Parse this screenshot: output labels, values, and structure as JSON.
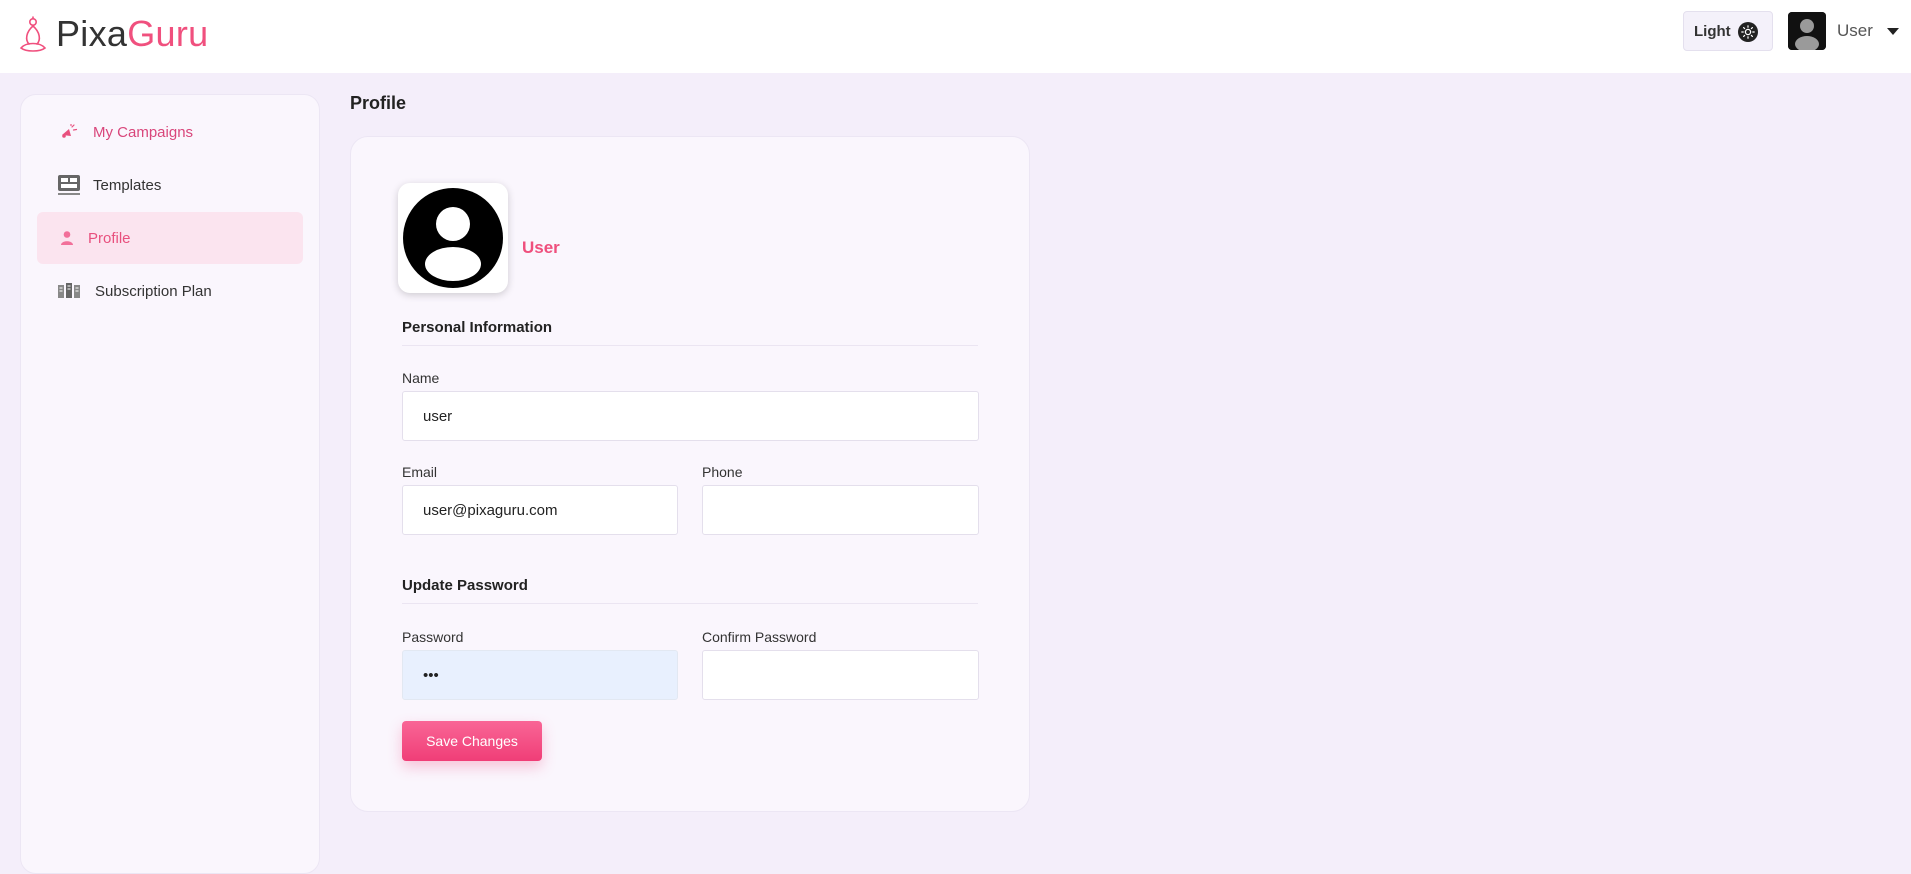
{
  "brand": {
    "name_part1": "Pixa",
    "name_part2": "Guru",
    "accent": "#f0507e"
  },
  "header": {
    "theme_label": "Light",
    "theme_icon": "sun-icon",
    "user_name": "User"
  },
  "sidebar": {
    "items": [
      {
        "label": "My Campaigns",
        "icon": "megaphone-icon",
        "active": false
      },
      {
        "label": "Templates",
        "icon": "templates-icon",
        "active": false
      },
      {
        "label": "Profile",
        "icon": "person-icon",
        "active": true
      },
      {
        "label": "Subscription Plan",
        "icon": "subscription-icon",
        "active": false
      }
    ]
  },
  "main": {
    "page_title": "Profile",
    "profile": {
      "display_name": "User"
    },
    "personal_info": {
      "title": "Personal Information",
      "name_label": "Name",
      "name_value": "user",
      "email_label": "Email",
      "email_value": "user@pixaguru.com",
      "phone_label": "Phone",
      "phone_value": ""
    },
    "password": {
      "title": "Update Password",
      "password_label": "Password",
      "password_value": "•••",
      "confirm_label": "Confirm Password",
      "confirm_value": ""
    },
    "save_label": "Save Changes"
  }
}
